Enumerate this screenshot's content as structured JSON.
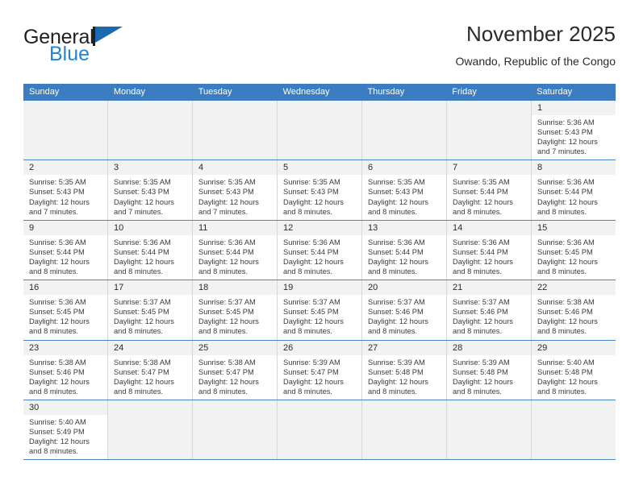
{
  "brand": {
    "name_top": "General",
    "name_bottom": "Blue",
    "flag_icon": "brand-flag-icon",
    "colors": {
      "dark": "#231f20",
      "blue": "#2284d6",
      "flag": "#1c69b2"
    }
  },
  "header": {
    "title": "November 2025",
    "subtitle": "Owando, Republic of the Congo"
  },
  "colors": {
    "header_blue": "#3b7dc0",
    "row_divider": "#4a86c5",
    "cell_border": "#d7d7d7",
    "day_band": "#f2f2f2",
    "text": "#3b3b3b"
  },
  "weekdays": [
    "Sunday",
    "Monday",
    "Tuesday",
    "Wednesday",
    "Thursday",
    "Friday",
    "Saturday"
  ],
  "weeks": [
    [
      {
        "empty": true
      },
      {
        "empty": true
      },
      {
        "empty": true
      },
      {
        "empty": true
      },
      {
        "empty": true
      },
      {
        "empty": true
      },
      {
        "day": "1",
        "sunrise": "Sunrise: 5:36 AM",
        "sunset": "Sunset: 5:43 PM",
        "daylight": "Daylight: 12 hours and 7 minutes."
      }
    ],
    [
      {
        "day": "2",
        "sunrise": "Sunrise: 5:35 AM",
        "sunset": "Sunset: 5:43 PM",
        "daylight": "Daylight: 12 hours and 7 minutes."
      },
      {
        "day": "3",
        "sunrise": "Sunrise: 5:35 AM",
        "sunset": "Sunset: 5:43 PM",
        "daylight": "Daylight: 12 hours and 7 minutes."
      },
      {
        "day": "4",
        "sunrise": "Sunrise: 5:35 AM",
        "sunset": "Sunset: 5:43 PM",
        "daylight": "Daylight: 12 hours and 7 minutes."
      },
      {
        "day": "5",
        "sunrise": "Sunrise: 5:35 AM",
        "sunset": "Sunset: 5:43 PM",
        "daylight": "Daylight: 12 hours and 8 minutes."
      },
      {
        "day": "6",
        "sunrise": "Sunrise: 5:35 AM",
        "sunset": "Sunset: 5:43 PM",
        "daylight": "Daylight: 12 hours and 8 minutes."
      },
      {
        "day": "7",
        "sunrise": "Sunrise: 5:35 AM",
        "sunset": "Sunset: 5:44 PM",
        "daylight": "Daylight: 12 hours and 8 minutes."
      },
      {
        "day": "8",
        "sunrise": "Sunrise: 5:36 AM",
        "sunset": "Sunset: 5:44 PM",
        "daylight": "Daylight: 12 hours and 8 minutes."
      }
    ],
    [
      {
        "day": "9",
        "sunrise": "Sunrise: 5:36 AM",
        "sunset": "Sunset: 5:44 PM",
        "daylight": "Daylight: 12 hours and 8 minutes."
      },
      {
        "day": "10",
        "sunrise": "Sunrise: 5:36 AM",
        "sunset": "Sunset: 5:44 PM",
        "daylight": "Daylight: 12 hours and 8 minutes."
      },
      {
        "day": "11",
        "sunrise": "Sunrise: 5:36 AM",
        "sunset": "Sunset: 5:44 PM",
        "daylight": "Daylight: 12 hours and 8 minutes."
      },
      {
        "day": "12",
        "sunrise": "Sunrise: 5:36 AM",
        "sunset": "Sunset: 5:44 PM",
        "daylight": "Daylight: 12 hours and 8 minutes."
      },
      {
        "day": "13",
        "sunrise": "Sunrise: 5:36 AM",
        "sunset": "Sunset: 5:44 PM",
        "daylight": "Daylight: 12 hours and 8 minutes."
      },
      {
        "day": "14",
        "sunrise": "Sunrise: 5:36 AM",
        "sunset": "Sunset: 5:44 PM",
        "daylight": "Daylight: 12 hours and 8 minutes."
      },
      {
        "day": "15",
        "sunrise": "Sunrise: 5:36 AM",
        "sunset": "Sunset: 5:45 PM",
        "daylight": "Daylight: 12 hours and 8 minutes."
      }
    ],
    [
      {
        "day": "16",
        "sunrise": "Sunrise: 5:36 AM",
        "sunset": "Sunset: 5:45 PM",
        "daylight": "Daylight: 12 hours and 8 minutes."
      },
      {
        "day": "17",
        "sunrise": "Sunrise: 5:37 AM",
        "sunset": "Sunset: 5:45 PM",
        "daylight": "Daylight: 12 hours and 8 minutes."
      },
      {
        "day": "18",
        "sunrise": "Sunrise: 5:37 AM",
        "sunset": "Sunset: 5:45 PM",
        "daylight": "Daylight: 12 hours and 8 minutes."
      },
      {
        "day": "19",
        "sunrise": "Sunrise: 5:37 AM",
        "sunset": "Sunset: 5:45 PM",
        "daylight": "Daylight: 12 hours and 8 minutes."
      },
      {
        "day": "20",
        "sunrise": "Sunrise: 5:37 AM",
        "sunset": "Sunset: 5:46 PM",
        "daylight": "Daylight: 12 hours and 8 minutes."
      },
      {
        "day": "21",
        "sunrise": "Sunrise: 5:37 AM",
        "sunset": "Sunset: 5:46 PM",
        "daylight": "Daylight: 12 hours and 8 minutes."
      },
      {
        "day": "22",
        "sunrise": "Sunrise: 5:38 AM",
        "sunset": "Sunset: 5:46 PM",
        "daylight": "Daylight: 12 hours and 8 minutes."
      }
    ],
    [
      {
        "day": "23",
        "sunrise": "Sunrise: 5:38 AM",
        "sunset": "Sunset: 5:46 PM",
        "daylight": "Daylight: 12 hours and 8 minutes."
      },
      {
        "day": "24",
        "sunrise": "Sunrise: 5:38 AM",
        "sunset": "Sunset: 5:47 PM",
        "daylight": "Daylight: 12 hours and 8 minutes."
      },
      {
        "day": "25",
        "sunrise": "Sunrise: 5:38 AM",
        "sunset": "Sunset: 5:47 PM",
        "daylight": "Daylight: 12 hours and 8 minutes."
      },
      {
        "day": "26",
        "sunrise": "Sunrise: 5:39 AM",
        "sunset": "Sunset: 5:47 PM",
        "daylight": "Daylight: 12 hours and 8 minutes."
      },
      {
        "day": "27",
        "sunrise": "Sunrise: 5:39 AM",
        "sunset": "Sunset: 5:48 PM",
        "daylight": "Daylight: 12 hours and 8 minutes."
      },
      {
        "day": "28",
        "sunrise": "Sunrise: 5:39 AM",
        "sunset": "Sunset: 5:48 PM",
        "daylight": "Daylight: 12 hours and 8 minutes."
      },
      {
        "day": "29",
        "sunrise": "Sunrise: 5:40 AM",
        "sunset": "Sunset: 5:48 PM",
        "daylight": "Daylight: 12 hours and 8 minutes."
      }
    ],
    [
      {
        "day": "30",
        "sunrise": "Sunrise: 5:40 AM",
        "sunset": "Sunset: 5:49 PM",
        "daylight": "Daylight: 12 hours and 8 minutes."
      },
      {
        "empty": true
      },
      {
        "empty": true
      },
      {
        "empty": true
      },
      {
        "empty": true
      },
      {
        "empty": true
      },
      {
        "empty": true
      }
    ]
  ]
}
